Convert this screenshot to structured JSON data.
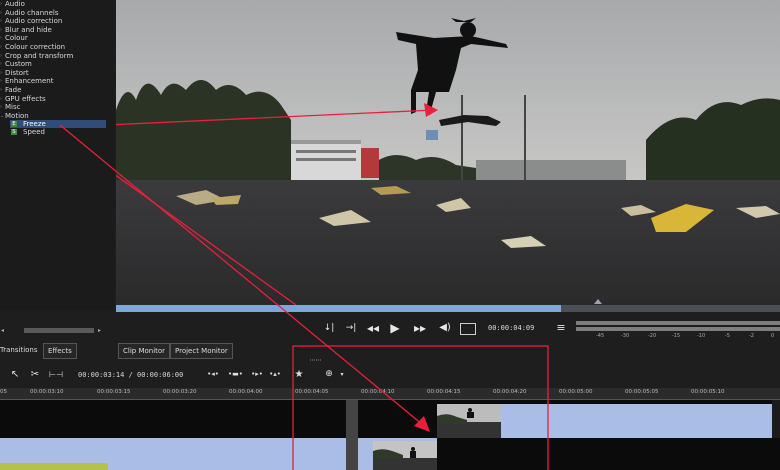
{
  "effects_tree": {
    "categories": [
      "Audio",
      "Audio channels",
      "Audio correction",
      "Blur and hide",
      "Colour",
      "Colour correction",
      "Crop and transform",
      "Custom",
      "Distort",
      "Enhancement",
      "Fade",
      "GPU effects",
      "Misc",
      "Motion"
    ],
    "motion_children": [
      {
        "label": "Freeze",
        "selected": true
      },
      {
        "label": "Speed",
        "selected": false
      }
    ]
  },
  "monitor": {
    "progress_fraction": 0.67
  },
  "transport": {
    "timecode": "00:00:04:09",
    "vu_ticks": [
      "-45",
      "-30",
      "-20",
      "-15",
      "-10",
      "-5",
      "-2",
      "0"
    ]
  },
  "tabs": {
    "transitions": "Transitions",
    "effects": "Effects",
    "clip_monitor": "Clip Monitor",
    "project_monitor": "Project Monitor"
  },
  "timeline": {
    "position": "00:00:03:14 / 00:00:06:00",
    "ruler_ticks": [
      "05",
      "00:00:03:10",
      "00:00:03:15",
      "00:00:03:20",
      "00:00:04:00",
      "00:00:04:05",
      "00:00:04:10",
      "00:00:04:15",
      "00:00:04:20",
      "00:00:05:00",
      "00:00:05:05",
      "00:00:05:10"
    ]
  },
  "colors": {
    "selection": "#2f4d78",
    "clip_blue": "#a9bde6",
    "annotation_red": "#e8203c",
    "fx_green": "#3c8a3c"
  },
  "icons": [
    "pointer-icon",
    "razor-icon",
    "spacer-icon",
    "rewind-icon",
    "play-icon",
    "fast-forward-icon",
    "volume-icon",
    "fullscreen-icon",
    "menu-icon",
    "star-icon"
  ]
}
